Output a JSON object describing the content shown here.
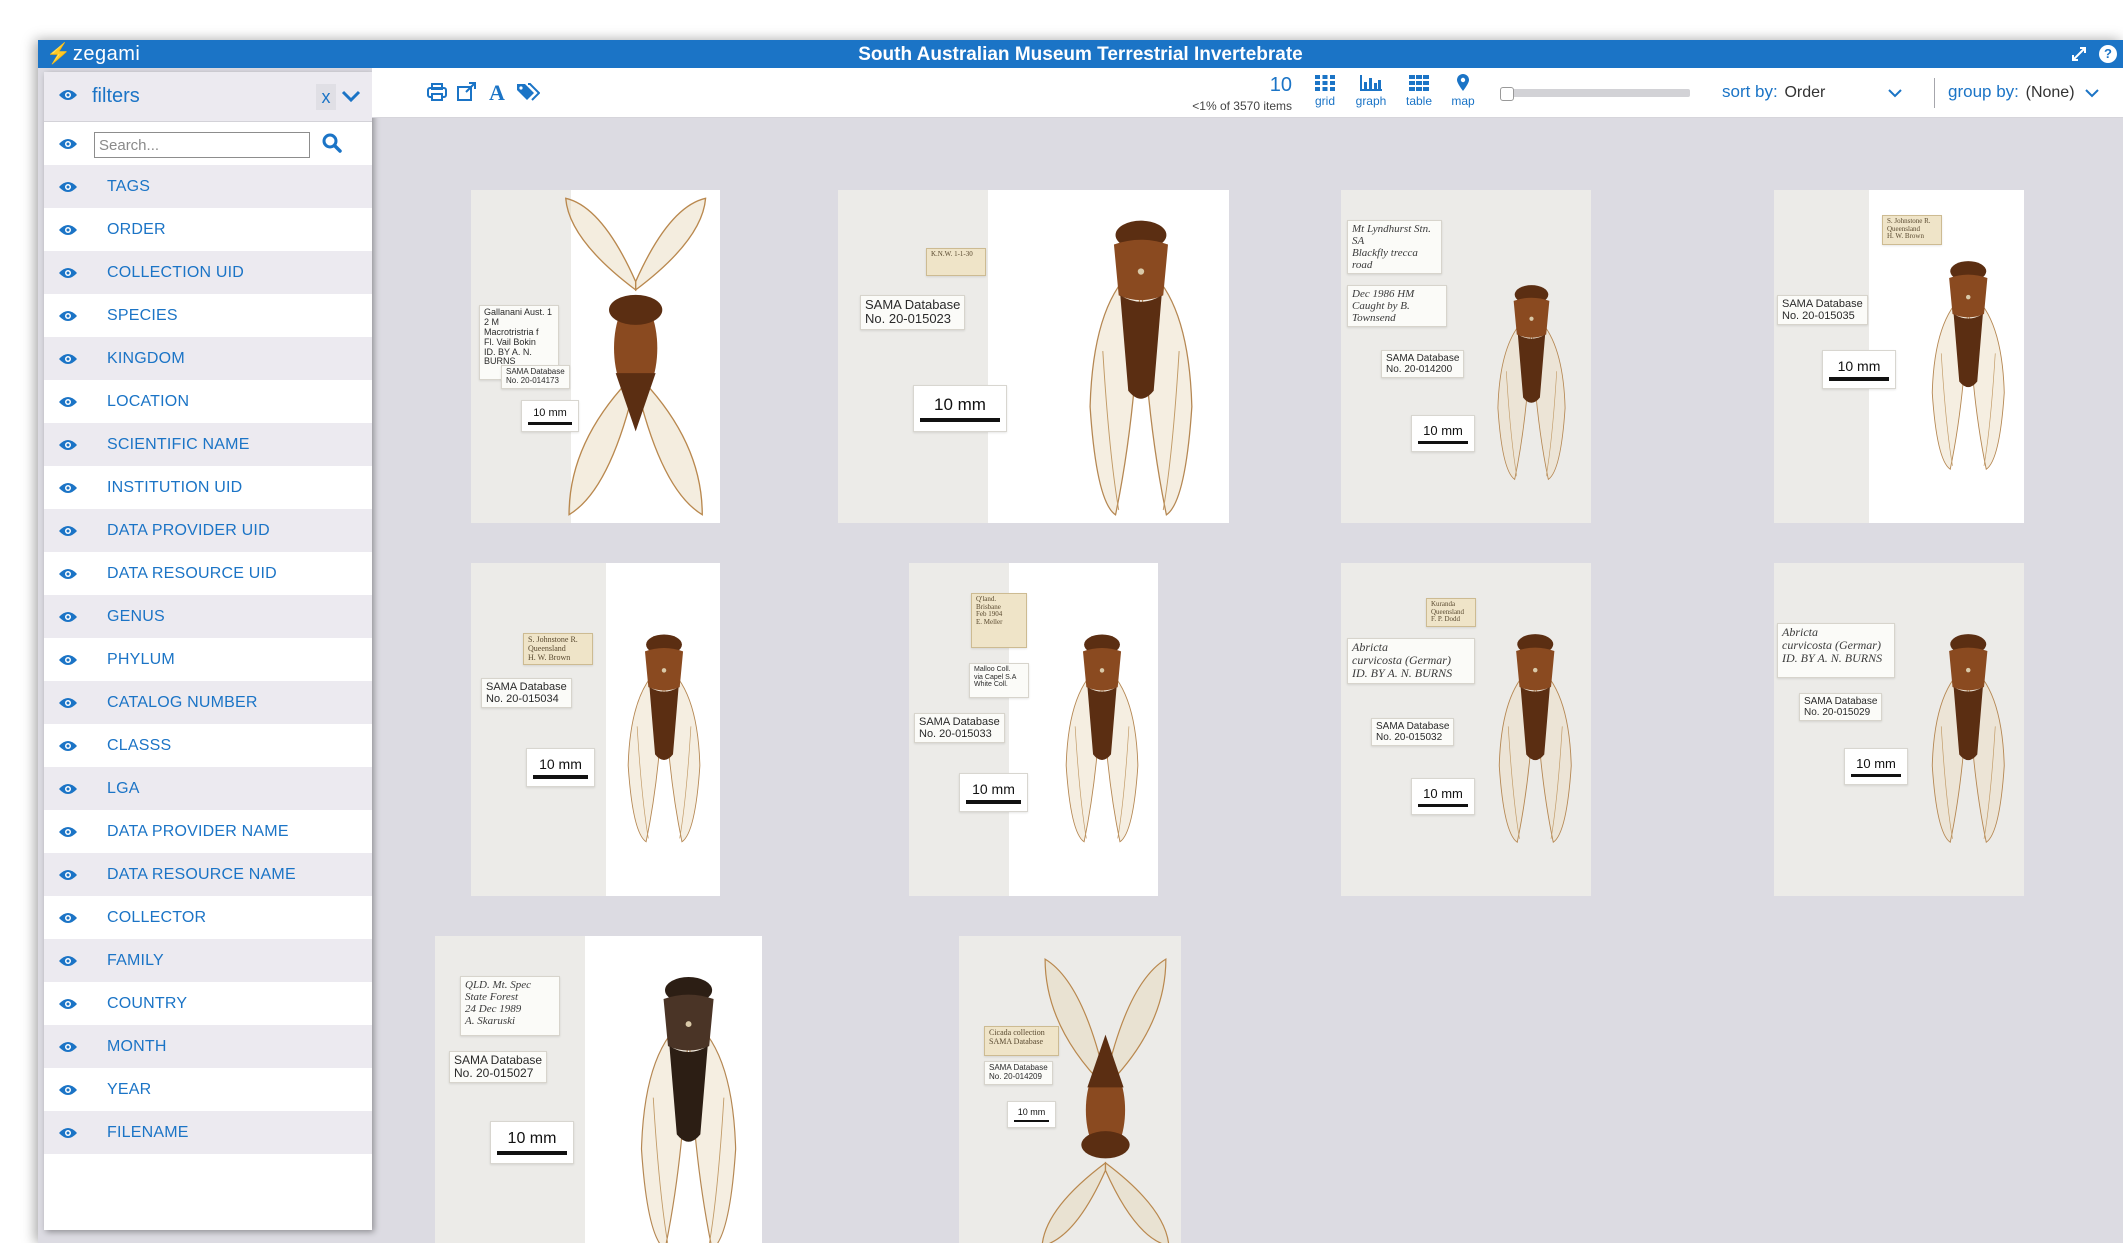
{
  "app": {
    "logo_text": "zegami",
    "title": "South Australian Museum Terrestrial Invertebrate"
  },
  "titlebar_icons": [
    "expand-icon",
    "help-icon"
  ],
  "filters": {
    "title": "filters",
    "clear_label": "x",
    "search_placeholder": "Search...",
    "items": [
      "TAGS",
      "ORDER",
      "COLLECTION UID",
      "SPECIES",
      "KINGDOM",
      "LOCATION",
      "SCIENTIFIC NAME",
      "INSTITUTION UID",
      "DATA PROVIDER UID",
      "DATA RESOURCE UID",
      "GENUS",
      "PHYLUM",
      "CATALOG NUMBER",
      "CLASSS",
      "LGA",
      "DATA PROVIDER NAME",
      "DATA RESOURCE NAME",
      "COLLECTOR",
      "FAMILY",
      "COUNTRY",
      "MONTH",
      "YEAR",
      "FILENAME"
    ]
  },
  "toolbar": {
    "icons": [
      "print-icon",
      "external-link-icon",
      "font-icon",
      "tags-icon"
    ],
    "count": "10",
    "count_sub": "<1% of 3570 items",
    "views": [
      {
        "label": "grid",
        "icon": "grid-icon"
      },
      {
        "label": "graph",
        "icon": "graph-icon"
      },
      {
        "label": "table",
        "icon": "table-icon"
      },
      {
        "label": "map",
        "icon": "map-pin-icon"
      }
    ],
    "zoom_level": 0,
    "sort_label": "sort by:",
    "sort_value": "Order",
    "group_label": "group by:",
    "group_value": "(None)"
  },
  "specimens": [
    {
      "labels": [
        "Gallanani Aust. 1 2 M",
        "Macrotristria f",
        "Fl. Vail Bokin",
        "ID. BY A. N. BURNS"
      ],
      "db_label": "SAMA Database",
      "db_no": "No.  20-014173",
      "scale": "10 mm"
    },
    {
      "labels": [
        "K.N.W. 1-1-30"
      ],
      "db_label": "SAMA Database",
      "db_no": "No.  20-015023",
      "scale": "10 mm"
    },
    {
      "labels": [
        "Mt Lyndhurst Stn. SA",
        "Blackfly trecca road",
        "Dec 1986 HM",
        "Caught by B. Townsend"
      ],
      "db_label": "SAMA Database",
      "db_no": "No.  20-014200",
      "scale": "10 mm"
    },
    {
      "labels": [
        "S. Johnstone R.",
        "Queensland",
        "H. W. Brown"
      ],
      "db_label": "SAMA Database",
      "db_no": "No.  20-015035",
      "scale": "10 mm"
    },
    {
      "labels": [
        "S. Johnstone R.",
        "Queensland",
        "H. W. Brown"
      ],
      "db_label": "SAMA Database",
      "db_no": "No.  20-015034",
      "scale": "10 mm"
    },
    {
      "labels": [
        "Q'land.",
        "Brisbane",
        "Feb 1904",
        "E. Meller",
        "Malloo Coll.",
        "via Capel S.A",
        "White Coll."
      ],
      "db_label": "SAMA Database",
      "db_no": "No.  20-015033",
      "scale": "10 mm"
    },
    {
      "labels": [
        "Kuranda",
        "Queensland",
        "F. P. Dodd",
        "Abricta",
        "curvicosta (Germar)",
        "ID. BY A. N. BURNS"
      ],
      "db_label": "SAMA Database",
      "db_no": "No.  20-015032",
      "scale": "10 mm"
    },
    {
      "labels": [
        "Abricta",
        "curvicosta (Germar)",
        "ID. BY A. N. BURNS"
      ],
      "db_label": "SAMA Database",
      "db_no": "No.  20-015029",
      "scale": "10 mm"
    },
    {
      "labels": [
        "QLD. Mt. Spec",
        "State Forest",
        "24 Dec 1989",
        "A. Skaruski"
      ],
      "db_label": "SAMA Database",
      "db_no": "No.  20-015027",
      "scale": "10 mm"
    },
    {
      "labels": [
        "Cicada collection",
        "SAMA Database"
      ],
      "db_label": "SAMA Database",
      "db_no": "No.  20-014209",
      "scale": "10 mm"
    }
  ]
}
